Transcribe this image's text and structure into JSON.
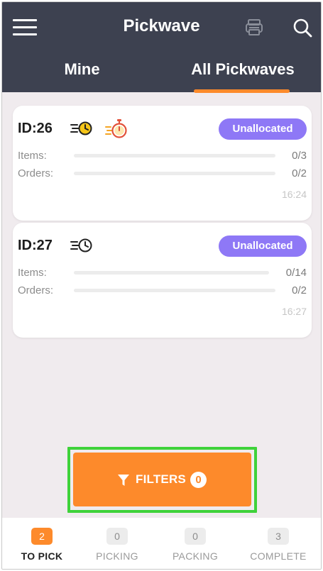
{
  "header": {
    "title": "Pickwave",
    "menu_icon": "hamburger-menu-icon",
    "printer_icon": "printer-icon",
    "search_icon": "search-icon",
    "background_color": "#3d4150"
  },
  "tabs": [
    {
      "label": "Mine",
      "active": false
    },
    {
      "label": "All Pickwaves",
      "active": true
    }
  ],
  "accent_color": "#fd8a2b",
  "pickwaves": [
    {
      "id_label": "ID:26",
      "icons": [
        "fast-clock-icon",
        "stopwatch-icon"
      ],
      "status": "Unallocated",
      "items_label": "Items:",
      "items_value": "0/3",
      "items_progress": 0,
      "orders_label": "Orders:",
      "orders_value": "0/2",
      "orders_progress": 0,
      "time": "16:24"
    },
    {
      "id_label": "ID:27",
      "icons": [
        "fast-clock-icon"
      ],
      "status": "Unallocated",
      "items_label": "Items:",
      "items_value": "0/14",
      "items_progress": 0,
      "orders_label": "Orders:",
      "orders_value": "0/2",
      "orders_progress": 0,
      "time": "16:27"
    }
  ],
  "status_color": "#8e78f6",
  "filters": {
    "label": "FILTERS",
    "count": "0",
    "icon": "funnel-icon"
  },
  "bottom_nav": [
    {
      "count": "2",
      "label": "TO PICK",
      "active": true
    },
    {
      "count": "0",
      "label": "PICKING",
      "active": false
    },
    {
      "count": "0",
      "label": "PACKING",
      "active": false
    },
    {
      "count": "3",
      "label": "COMPLETE",
      "active": false
    }
  ]
}
